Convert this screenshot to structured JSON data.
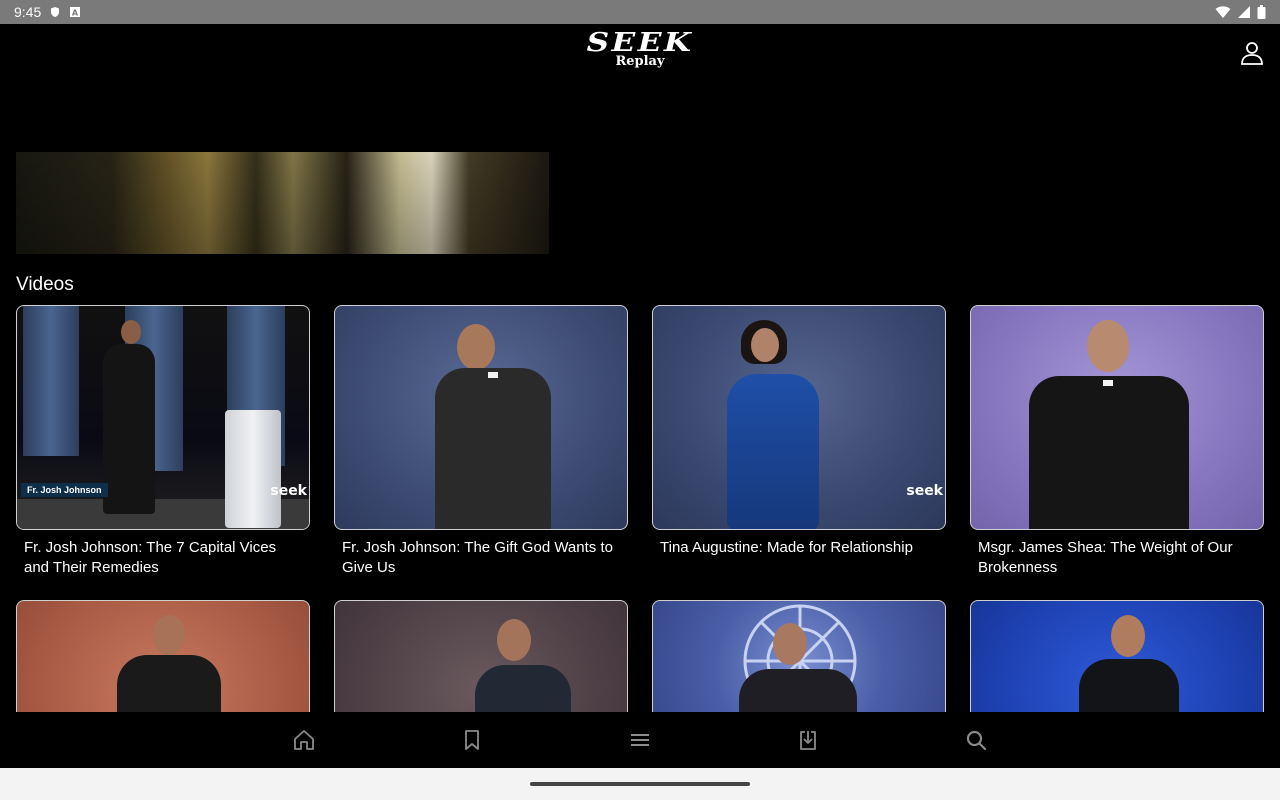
{
  "status_bar": {
    "time": "9:45",
    "icons": [
      "shield-icon",
      "a-icon",
      "wifi-icon",
      "signal-icon",
      "battery-icon"
    ]
  },
  "header": {
    "logo_main": "SEEK",
    "logo_sub": "Replay",
    "profile_icon": "person-icon"
  },
  "section": {
    "title": "Videos"
  },
  "videos": [
    {
      "title": "Fr. Josh Johnson: The 7 Capital Vices and Their Remedies",
      "name_tag": "Fr. Josh Johnson",
      "watermark": "seek"
    },
    {
      "title": "Fr. Josh Johnson: The Gift God Wants to Give Us",
      "watermark": ""
    },
    {
      "title": "Tina Augustine: Made for Relationship",
      "watermark": "seek"
    },
    {
      "title": "Msgr. James Shea: The Weight of Our Brokenness",
      "watermark": ""
    },
    {
      "title": "",
      "watermark": ""
    },
    {
      "title": "",
      "watermark": ""
    },
    {
      "title": "",
      "watermark": ""
    },
    {
      "title": "",
      "watermark": ""
    }
  ],
  "bottom_nav": [
    {
      "icon": "home-icon"
    },
    {
      "icon": "bookmark-icon"
    },
    {
      "icon": "menu-icon"
    },
    {
      "icon": "download-icon"
    },
    {
      "icon": "search-icon"
    }
  ],
  "colors": {
    "background": "#000000",
    "status_bar": "#7a7a7a",
    "card_border": "#d0d0d0",
    "nav_icon": "#8a8a8a"
  }
}
